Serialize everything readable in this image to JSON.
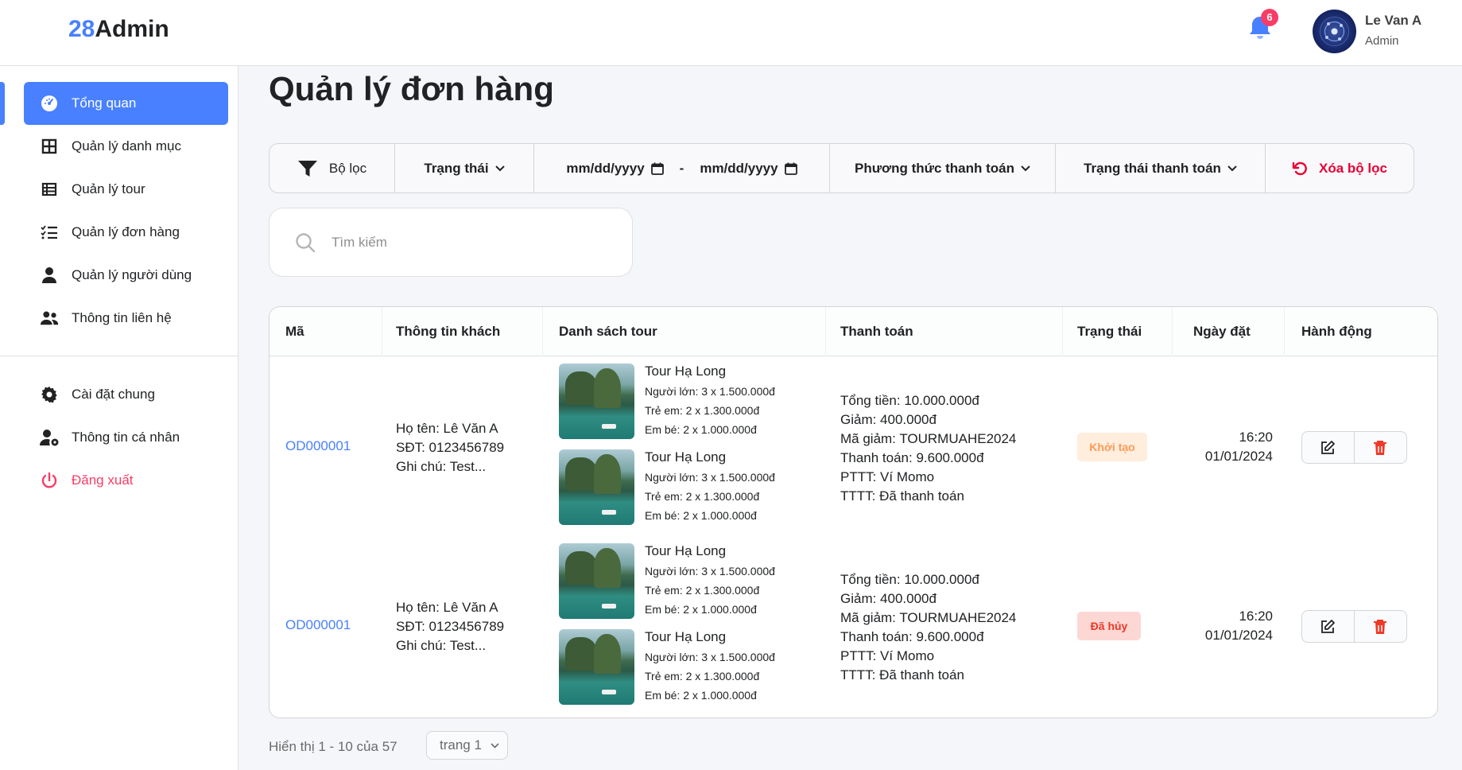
{
  "header": {
    "logo_prefix": "28",
    "logo_suffix": "Admin",
    "notification_count": "6",
    "user_name": "Le Van A",
    "user_role": "Admin"
  },
  "sidebar": {
    "items": [
      {
        "label": "Tổng quan",
        "icon": "dashboard-icon"
      },
      {
        "label": "Quản lý danh mục",
        "icon": "grid-icon"
      },
      {
        "label": "Quản lý tour",
        "icon": "table-icon"
      },
      {
        "label": "Quản lý đơn hàng",
        "icon": "list-check-icon"
      },
      {
        "label": "Quản lý người dùng",
        "icon": "user-icon"
      },
      {
        "label": "Thông tin liên hệ",
        "icon": "users-icon"
      }
    ],
    "bottom_items": [
      {
        "label": "Cài đặt chung",
        "icon": "gear-icon"
      },
      {
        "label": "Thông tin cá nhân",
        "icon": "user-gear-icon"
      },
      {
        "label": "Đăng xuất",
        "icon": "power-icon"
      }
    ]
  },
  "page_title": "Quản lý đơn hàng",
  "filters": {
    "filter_label": "Bộ lọc",
    "status": "Trạng thái",
    "date_from": "mm/dd/yyyy",
    "date_separator": "-",
    "date_to": "mm/dd/yyyy",
    "payment_method": "Phương thức thanh toán",
    "payment_status": "Trạng thái thanh toán",
    "reset": "Xóa bộ lọc"
  },
  "search": {
    "placeholder": "Tìm kiếm"
  },
  "table": {
    "headers": [
      "Mã",
      "Thông tin khách",
      "Danh sách tour",
      "Thanh toán",
      "Trạng thái",
      "Ngày đặt",
      "Hành động"
    ],
    "rows": [
      {
        "code": "OD000001",
        "customer": {
          "name": "Họ tên: Lê Văn A",
          "phone": "SĐT: 0123456789",
          "note": "Ghi chú: Test..."
        },
        "tours": [
          {
            "name": "Tour Hạ Long",
            "adult": "Người lớn: 3 x 1.500.000đ",
            "child": "Trẻ em: 2 x 1.300.000đ",
            "baby": "Em bé: 2 x 1.000.000đ"
          },
          {
            "name": "Tour Hạ Long",
            "adult": "Người lớn: 3 x 1.500.000đ",
            "child": "Trẻ em: 2 x 1.300.000đ",
            "baby": "Em bé: 2 x 1.000.000đ"
          }
        ],
        "payment": {
          "total": "Tổng tiền: 10.000.000đ",
          "discount": "Giảm: 400.000đ",
          "coupon": "Mã giảm: TOURMUAHE2024",
          "paid": "Thanh toán: 9.600.000đ",
          "method": "PTTT: Ví Momo",
          "status": "TTTT: Đã thanh toán"
        },
        "status": "Khởi tạo",
        "time": "16:20",
        "date": "01/01/2024"
      },
      {
        "code": "OD000001",
        "customer": {
          "name": "Họ tên: Lê Văn A",
          "phone": "SĐT: 0123456789",
          "note": "Ghi chú: Test..."
        },
        "tours": [
          {
            "name": "Tour Hạ Long",
            "adult": "Người lớn: 3 x 1.500.000đ",
            "child": "Trẻ em: 2 x 1.300.000đ",
            "baby": "Em bé: 2 x 1.000.000đ"
          },
          {
            "name": "Tour Hạ Long",
            "adult": "Người lớn: 3 x 1.500.000đ",
            "child": "Trẻ em: 2 x 1.300.000đ",
            "baby": "Em bé: 2 x 1.000.000đ"
          }
        ],
        "payment": {
          "total": "Tổng tiền: 10.000.000đ",
          "discount": "Giảm: 400.000đ",
          "coupon": "Mã giảm: TOURMUAHE2024",
          "paid": "Thanh toán: 9.600.000đ",
          "method": "PTTT: Ví Momo",
          "status": "TTTT: Đã thanh toán"
        },
        "status": "Đã hủy",
        "time": "16:20",
        "date": "01/01/2024"
      }
    ]
  },
  "footer": {
    "summary": "Hiển thị 1 - 10 của 57",
    "page_select": "trang 1"
  },
  "colors": {
    "accent": "#4880ff",
    "danger": "#ea0234",
    "badge_init_bg": "#ffeddd",
    "badge_init_text": "#fd9a56",
    "badge_cancel_bg": "#fcd7d4",
    "badge_cancel_text": "#ef3826"
  }
}
